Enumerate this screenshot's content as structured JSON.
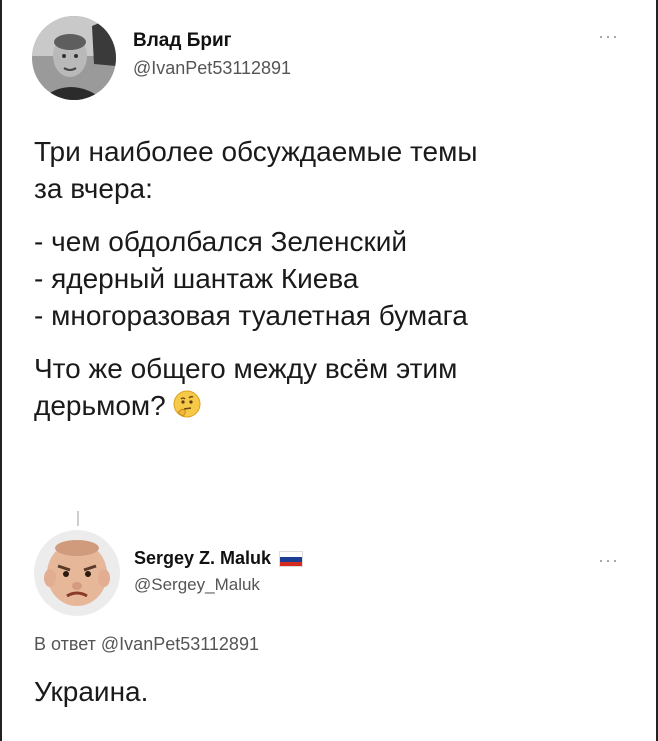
{
  "tweet": {
    "author_name": "Влад Бриг",
    "author_handle": "@IvanPet53112891",
    "more_label": "···",
    "paragraphs": [
      [
        "Три наиболее обсуждаемые темы",
        "за вчера:"
      ],
      [
        "- чем обдолбался Зеленский",
        "- ядерный шантаж Киева",
        "- многоразовая туалетная бумага"
      ]
    ],
    "last_line_1": "Что же общего между всём этим",
    "last_line_2": "дерьмом?",
    "emoji_icon": "thinking-face-icon"
  },
  "reply": {
    "author_name": "Sergey Z. Maluk",
    "author_handle": "@Sergey_Maluk",
    "more_label": "···",
    "flag_icon": "russia-flag-icon",
    "reply_prefix": "В ответ",
    "reply_mention": "@IvanPet53112891",
    "text": "Украина."
  },
  "colors": {
    "muted_text": "#555555",
    "flag_white": "#ffffff",
    "flag_blue": "#1c3f94",
    "flag_red": "#d52b1e"
  }
}
